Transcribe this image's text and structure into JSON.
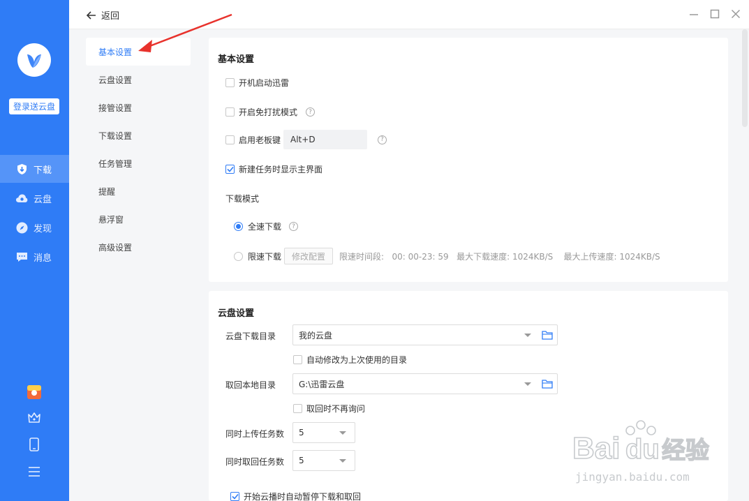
{
  "sidebar": {
    "login_label": "登录送云盘",
    "nav": [
      {
        "label": "下载",
        "icon": "download-shield-icon",
        "active": true
      },
      {
        "label": "云盘",
        "icon": "cloud-icon",
        "active": false
      },
      {
        "label": "发现",
        "icon": "compass-icon",
        "active": false
      },
      {
        "label": "消息",
        "icon": "message-icon",
        "active": false
      }
    ],
    "bottom_icons": [
      "gift-box-icon",
      "crown-icon",
      "phone-icon",
      "menu-icon"
    ]
  },
  "topbar": {
    "back_label": "返回"
  },
  "categories": [
    {
      "label": "基本设置",
      "active": true
    },
    {
      "label": "云盘设置"
    },
    {
      "label": "接管设置"
    },
    {
      "label": "下载设置"
    },
    {
      "label": "任务管理"
    },
    {
      "label": "提醒"
    },
    {
      "label": "悬浮窗"
    },
    {
      "label": "高级设置"
    }
  ],
  "basic": {
    "title": "基本设置",
    "autostart": "开机启动迅雷",
    "no_disturb": "开启免打扰模式",
    "boss_key": "启用老板键",
    "boss_key_value": "Alt+D",
    "show_main": "新建任务时显示主界面",
    "mode_title": "下载模式",
    "full_speed": "全速下载",
    "limit_speed": "限速下载",
    "modify_btn": "修改配置",
    "limit_info": "限速时间段:   00: 00-23: 59   最大下载速度: 1024KB/S    最大上传速度: 1024KB/S"
  },
  "cloud": {
    "title": "云盘设置",
    "dl_dir_label": "云盘下载目录",
    "dl_dir_value": "我的云盘",
    "auto_modify": "自动修改为上次使用的目录",
    "local_dir_label": "取回本地目录",
    "local_dir_value": "G:\\迅雷云盘",
    "no_ask": "取回时不再询问",
    "upload_label": "同时上传任务数",
    "upload_value": "5",
    "fetch_label": "同时取回任务数",
    "fetch_value": "5",
    "auto_pause": "开始云播时自动暂停下载和取回"
  },
  "watermark": {
    "brand": "Bai",
    "brand2": "du",
    "cn": "经验",
    "url": "jingyan.baidu.com"
  },
  "colors": {
    "accent": "#2f7cf6",
    "annotation": "#e8322c"
  }
}
